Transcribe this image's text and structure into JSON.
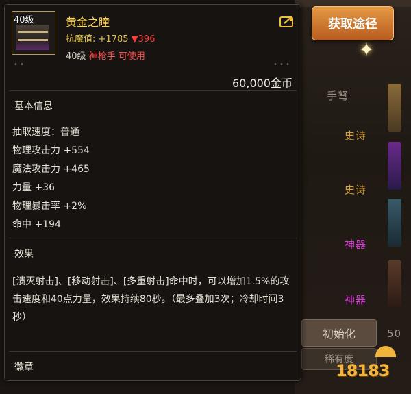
{
  "background": {
    "acquire_button": "获取途径",
    "tab_label": "手弩",
    "labels": [
      "史诗",
      "史诗",
      "神器",
      "神器"
    ],
    "reset_button": "初始化",
    "bottom_button": "稀有度",
    "number_fragment": "50"
  },
  "item": {
    "icon_level": "40级",
    "name": "黄金之瞳",
    "resist_label": "抗魔值:",
    "resist_value": "+1785",
    "resist_down": "▼396",
    "req_level": "40级",
    "req_class": "神枪手 可使用",
    "price": "60,000金币"
  },
  "basic_info": {
    "title": "基本信息",
    "stats": [
      "抽取速度：普通",
      "物理攻击力 +554",
      "魔法攻击力 +465",
      "力量 +36",
      "物理暴击率 +2%",
      "命中 +194"
    ]
  },
  "effect": {
    "title": "效果",
    "text": "[溃灭射击]、[移动射击]、[多重射击]命中时，可以增加1.5%的攻击速度和40点力量，效果持续80秒。（最多叠加3次；冷却时间3秒）"
  },
  "badge": {
    "title": "徽章"
  },
  "watermark": {
    "text": "18183"
  }
}
